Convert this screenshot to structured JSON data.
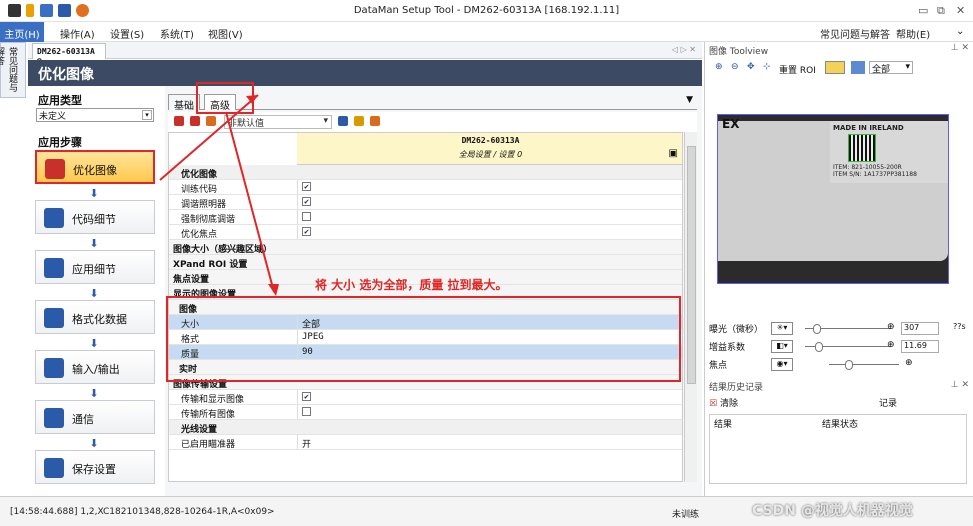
{
  "window": {
    "title": "DataMan Setup Tool - DM262-60313A [168.192.1.11]"
  },
  "menu": {
    "home": "主页(H)",
    "items": [
      "操作(A)",
      "设置(S)",
      "系统(T)",
      "视图(V)"
    ],
    "faq": "常见问题与解答",
    "help": "帮助(E)"
  },
  "vtab": "常见问题与解答",
  "doc_tab": "DM262-60313A",
  "header": "优化图像",
  "left": {
    "apptype_title": "应用类型",
    "apptype_value": "未定义",
    "steps_title": "应用步骤",
    "steps": [
      {
        "label": "优化图像",
        "icon": "sun-icon",
        "selected": true
      },
      {
        "label": "代码细节",
        "icon": "tools-icon"
      },
      {
        "label": "应用细节",
        "icon": "wrench-gear-icon"
      },
      {
        "label": "格式化数据",
        "icon": "format-data-icon"
      },
      {
        "label": "输入/输出",
        "icon": "gear-io-icon"
      },
      {
        "label": "通信",
        "icon": "network-icon"
      },
      {
        "label": "保存设置",
        "icon": "save-disk-icon"
      }
    ]
  },
  "prop": {
    "tab_basic": "基础",
    "tab_advanced": "高级",
    "combo": "非默认值",
    "device": "DM262-60313A",
    "config": "全局设置 / 设置 0",
    "rows": [
      {
        "k": "优化图像",
        "type": "cat"
      },
      {
        "k": "训练代码",
        "v": "✔",
        "type": "chk"
      },
      {
        "k": "调谐照明器",
        "v": "✔",
        "type": "chk"
      },
      {
        "k": "强制彻底调谐",
        "v": "",
        "type": "chk"
      },
      {
        "k": "优化焦点",
        "v": "✔",
        "type": "chk"
      },
      {
        "k": "图像大小（感兴趣区域）",
        "type": "sub"
      },
      {
        "k": "XPand ROI 设置",
        "type": "sub"
      },
      {
        "k": "焦点设置",
        "type": "sub"
      },
      {
        "k": "显示的图像设置",
        "type": "sub"
      },
      {
        "k": "图像",
        "type": "sub2"
      },
      {
        "k": "大小",
        "v": "全部",
        "type": "val",
        "blue": true
      },
      {
        "k": "格式",
        "v": "JPEG",
        "type": "val"
      },
      {
        "k": "质量",
        "v": "90",
        "type": "val",
        "blue": true
      },
      {
        "k": "实时",
        "type": "sub2"
      },
      {
        "k": "图像传输设置",
        "type": "sub"
      },
      {
        "k": "传输和显示图像",
        "v": "✔",
        "type": "chk"
      },
      {
        "k": "传输所有图像",
        "v": "",
        "type": "chk"
      },
      {
        "k": "光线设置",
        "type": "cat"
      },
      {
        "k": "已启用瞄准器",
        "v": "开",
        "type": "val"
      }
    ]
  },
  "annotation": "将 大小 选为全部，质量 拉到最大。",
  "right": {
    "toolview_title": "图像 Toolview",
    "reset_roi": "重置 ROI",
    "zoom_label": "全部",
    "img_label": {
      "l1": "MADE IN IRELAND",
      "l2": "ITEM: 821-10055-200R",
      "l3": "ITEM S/N: 1A1737PP381188",
      "ex": "EX"
    },
    "exposure_label": "曝光（微秒）",
    "exposure_value": "307",
    "exposure_unit": "??s",
    "gain_label": "增益系数",
    "gain_value": "11.69",
    "focus_label": "焦点",
    "results_title": "结果历史记录",
    "clear": "清除",
    "record": "记录",
    "col1": "结果",
    "col2": "结果状态"
  },
  "status": {
    "left": "[14:58:44.688] 1,2,XC182101348,828-10264-1R,A<0x09>",
    "mid": "未训练",
    "watermark": "CSDN @视觉人机器视觉"
  }
}
